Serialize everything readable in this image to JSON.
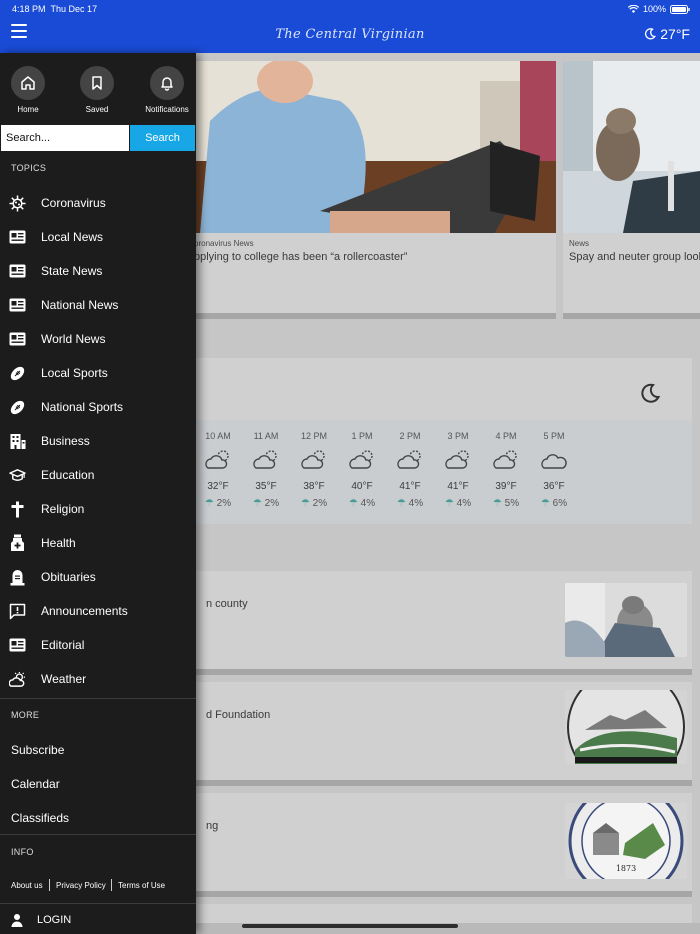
{
  "status": {
    "time": "4:18 PM",
    "date": "Thu Dec 17",
    "battery": "100%"
  },
  "header": {
    "masthead": "The Central Virginian",
    "temp": "27°F"
  },
  "drawer": {
    "quick": [
      {
        "label": "Home",
        "icon": "home-icon"
      },
      {
        "label": "Saved",
        "icon": "bookmark-icon"
      },
      {
        "label": "Notifications",
        "icon": "bell-icon"
      }
    ],
    "search": {
      "placeholder": "Search...",
      "button": "Search"
    },
    "topics_heading": "TOPICS",
    "topics": [
      {
        "label": "Coronavirus",
        "icon": "virus-icon"
      },
      {
        "label": "Local News",
        "icon": "newspaper-icon"
      },
      {
        "label": "State News",
        "icon": "newspaper-icon"
      },
      {
        "label": "National News",
        "icon": "newspaper-icon"
      },
      {
        "label": "World News",
        "icon": "newspaper-icon"
      },
      {
        "label": "Local Sports",
        "icon": "football-icon"
      },
      {
        "label": "National Sports",
        "icon": "football-icon"
      },
      {
        "label": "Business",
        "icon": "building-icon"
      },
      {
        "label": "Education",
        "icon": "graduation-cap-icon"
      },
      {
        "label": "Religion",
        "icon": "cross-icon"
      },
      {
        "label": "Health",
        "icon": "medicine-icon"
      },
      {
        "label": "Obituaries",
        "icon": "tombstone-icon"
      },
      {
        "label": "Announcements",
        "icon": "announcement-icon"
      },
      {
        "label": "Editorial",
        "icon": "newspaper-icon"
      },
      {
        "label": "Weather",
        "icon": "cloud-sun-icon"
      }
    ],
    "more_heading": "MORE",
    "more": [
      "Subscribe",
      "Calendar",
      "Classifieds"
    ],
    "info_heading": "INFO",
    "info_links": [
      "About us",
      "Privacy Policy",
      "Terms of Use"
    ],
    "login": "LOGIN"
  },
  "content": {
    "card1": {
      "kicker": "oronavirus News",
      "headline": "pplying to college has been “a rollercoaster”"
    },
    "card2": {
      "kicker": "News",
      "headline": "Spay and neuter group look"
    },
    "hourly": [
      {
        "time": "10 AM",
        "temp": "32°F",
        "precip": "2%"
      },
      {
        "time": "11 AM",
        "temp": "35°F",
        "precip": "2%"
      },
      {
        "time": "12 PM",
        "temp": "38°F",
        "precip": "2%"
      },
      {
        "time": "1 PM",
        "temp": "40°F",
        "precip": "4%"
      },
      {
        "time": "2 PM",
        "temp": "41°F",
        "precip": "4%"
      },
      {
        "time": "3 PM",
        "temp": "41°F",
        "precip": "4%"
      },
      {
        "time": "4 PM",
        "temp": "39°F",
        "precip": "5%"
      },
      {
        "time": "5 PM",
        "temp": "36°F",
        "precip": "6%"
      }
    ],
    "list": [
      {
        "headline": "n county"
      },
      {
        "headline": "d Foundation"
      },
      {
        "headline": "ng"
      }
    ],
    "seal_year": "1873"
  }
}
